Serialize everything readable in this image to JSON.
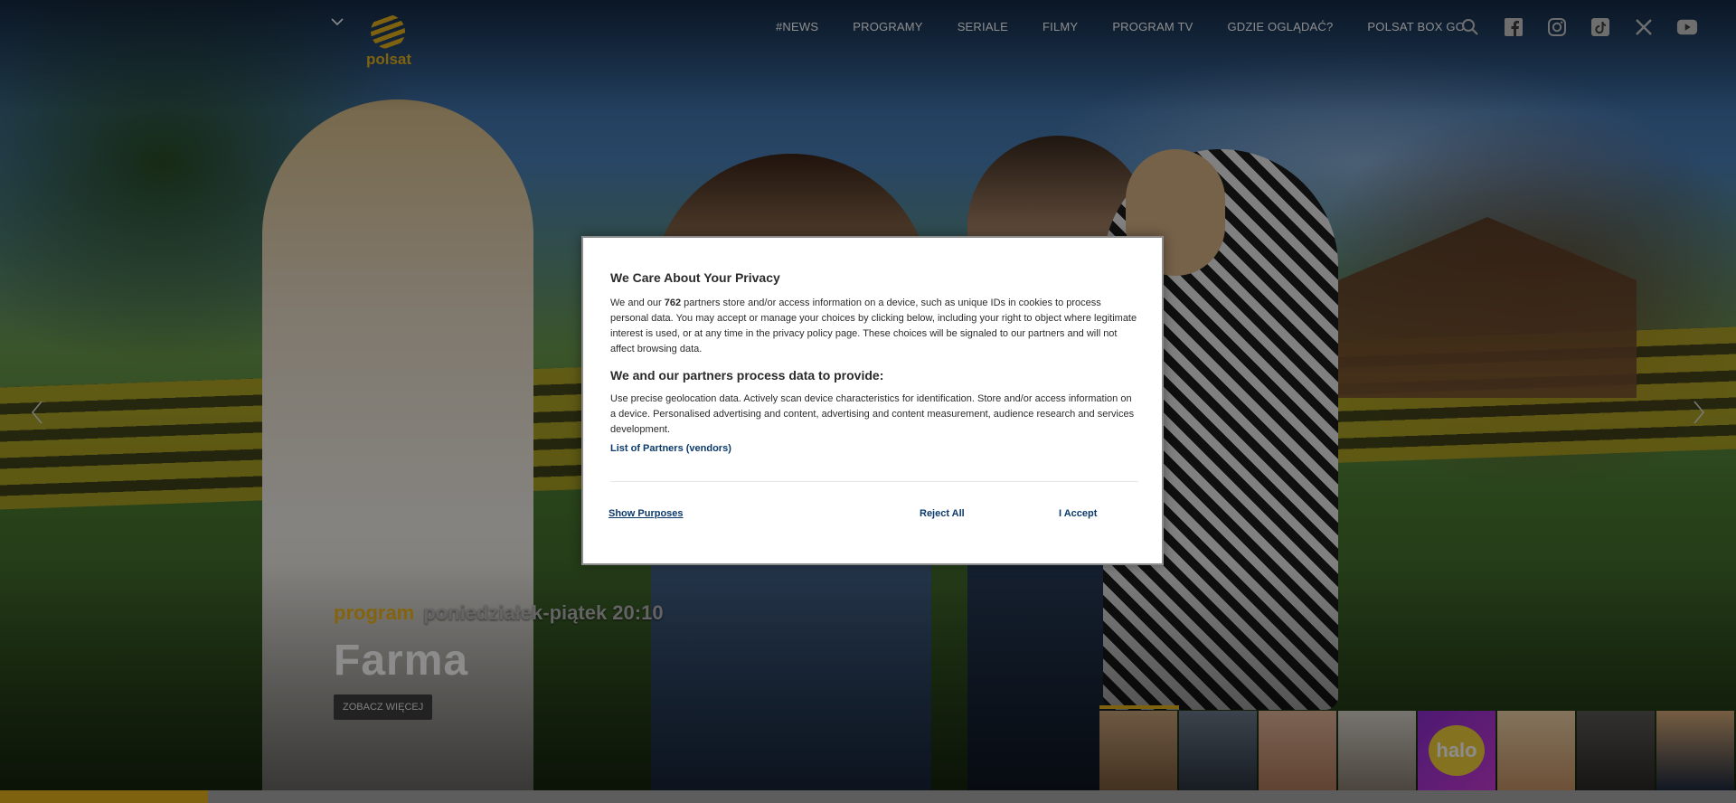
{
  "header": {
    "logo_text": "polsat",
    "nav": [
      "#NEWS",
      "PROGRAMY",
      "SERIALE",
      "FILMY",
      "PROGRAM TV",
      "GDZIE OGLĄDAĆ?",
      "POLSAT BOX GO"
    ],
    "icons": [
      "search-icon",
      "facebook-icon",
      "instagram-icon",
      "tiktok-icon",
      "x-icon",
      "youtube-icon"
    ]
  },
  "hero": {
    "type_label": "program",
    "schedule": "poniedziałek-piątek 20:10",
    "title": "Farma",
    "cta": "ZOBACZ WIĘCEJ",
    "thumbnail_logo": "halo",
    "progress": 0.12
  },
  "consent": {
    "title": "We Care About Your Privacy",
    "text_before": "We and our ",
    "partners_count": "762",
    "text_after": " partners store and/or access information on a device, such as unique IDs in cookies to process personal data. You may accept or manage your choices by clicking below, including your right to object where legitimate interest is used, or at any time in the privacy policy page. These choices will be signaled to our partners and will not affect browsing data.",
    "subtitle": "We and our partners process data to provide:",
    "purposes": "Use precise geolocation data. Actively scan device characteristics for identification. Store and/or access information on a device. Personalised advertising and content, advertising and content measurement, audience research and services development.",
    "partners_link": "List of Partners (vendors)",
    "show_purposes": "Show Purposes",
    "reject": "Reject All",
    "accept": "I Accept"
  },
  "colors": {
    "brand": "#e8b21c",
    "link": "#0b3a6b"
  }
}
